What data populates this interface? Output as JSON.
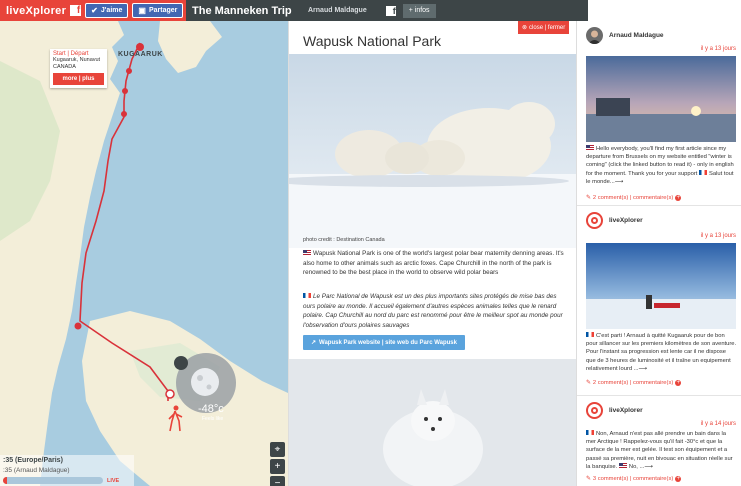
{
  "header": {
    "logo": "liveXplorer",
    "fb_like": "J'aime",
    "fb_share": "Partager",
    "trip_title": "The Manneken Trip",
    "owner": "Arnaud Maldague",
    "infos_button": "+ infos"
  },
  "map": {
    "start_popup": {
      "title": "Start | Départ",
      "line1": "Kugaaruk, Nunavut",
      "line2": "CANADA",
      "more_button": "more | plus"
    },
    "start_label": "KUGAARUK",
    "weather": {
      "temperature": "-48°c",
      "feels_like": "Feels like"
    },
    "time_local": ":35  (Europe/Paris)",
    "time_traveler": ":35 (Arnaud Maldague)",
    "progress": 0.04,
    "live_label": "LIVE",
    "controls": {
      "locate": "⌖",
      "zoom_in": "+",
      "zoom_out": "−"
    }
  },
  "article": {
    "close_button": "close | fermer",
    "title": "Wapusk National Park",
    "photo_credit": "photo credit : Destination Canada",
    "paragraph_en": "Wapusk National Park is one of the world's largest polar bear maternity denning areas. It's also home to other animals such as arctic foxes. Cape Churchill in the north of the park is renowned to be the best place in the world to observe wild polar bears",
    "paragraph_fr": "Le Parc National de Wapusk est un des plus importants sites protégés de mise bas des ours polaire au monde. Il accueil également d'autres espèces animales telles que le renard polaire. Cap Churchill au nord du parc est renommé pour être le meilleur spot au monde pour l'observation d'ours polaires sauvages",
    "site_button": "Wapusk Park website | site web du Parc Wapusk"
  },
  "feed": {
    "posts": [
      {
        "author": "Arnaud Maldague",
        "date": "il y a 13 jours",
        "text": "Hello everybody, you'll find my first article since my departure from Brussels on my website entitled \"winter is coming\" (click the linked button to read it) - only in english for the moment. Thank you for your support",
        "text_fr": "Salut tout le monde...",
        "comments": "2 comment(s) | commentaire(s)"
      },
      {
        "author": "liveXplorer",
        "date": "il y a 13 jours",
        "text": "C'est parti ! Arnaud à quitté Kugaaruk pour de bon pour sillancer sur les premiers kilomètres de son aventure. Pour l'instant sa progression est lente car il ne dispose que de 3 heures de luminosité et il traîne un equipement relativement lourd ...",
        "comments": "2 comment(s) | commentaire(s)"
      },
      {
        "author": "liveXplorer",
        "date": "il y a 14 jours",
        "text": "Non, Arnaud n'est pas allé prendre un bain dans la mer Arctique ! Rappelez-vous qu'il fait -30°c et que la surface de la mer est gelée. Il test son équipement et a passé sa première, nuit en bivouac en situation réelle sur la banquise.",
        "text_fr": "No, ...",
        "comments": "3 comment(s) | commentaire(s)"
      }
    ]
  }
}
